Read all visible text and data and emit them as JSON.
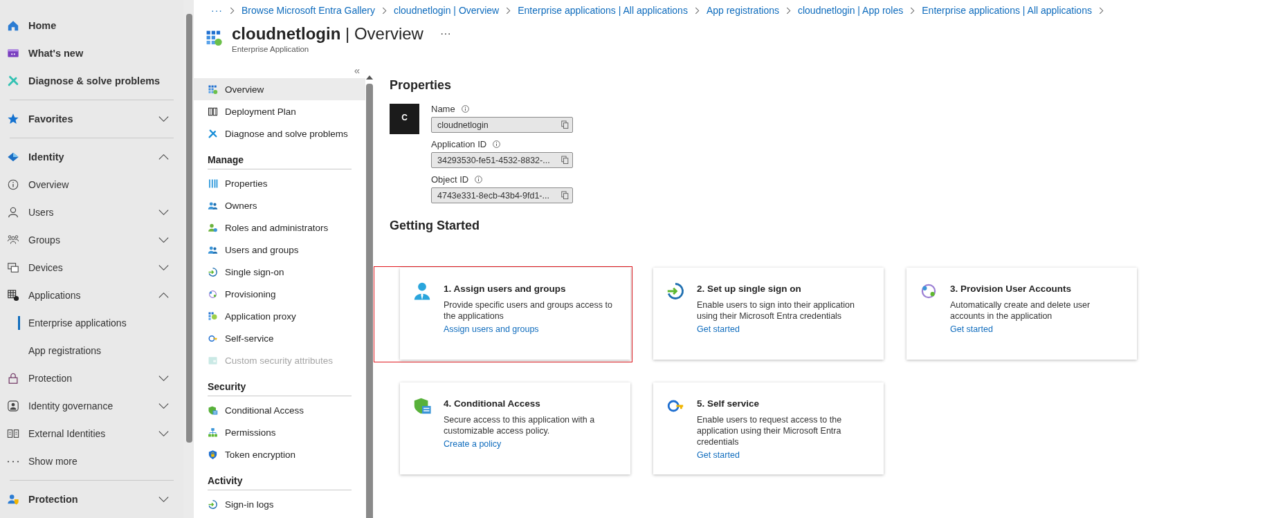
{
  "left_nav": {
    "groups": [
      {
        "items": [
          {
            "label": "Home",
            "kind": "top",
            "selected": false
          },
          {
            "label": "What's new",
            "kind": "top",
            "selected": false
          },
          {
            "label": "Diagnose & solve problems",
            "kind": "top",
            "selected": false
          }
        ]
      },
      {
        "items": [
          {
            "label": "Favorites",
            "kind": "top",
            "selected": false,
            "expanded": false
          }
        ]
      },
      {
        "items": [
          {
            "label": "Identity",
            "kind": "top",
            "selected": false,
            "expanded": true
          },
          {
            "label": "Overview",
            "kind": "item",
            "selected": false
          },
          {
            "label": "Users",
            "kind": "item",
            "selected": false,
            "expanded": false
          },
          {
            "label": "Groups",
            "kind": "item",
            "selected": false,
            "expanded": false
          },
          {
            "label": "Devices",
            "kind": "item",
            "selected": false,
            "expanded": false
          },
          {
            "label": "Applications",
            "kind": "item",
            "selected": false,
            "expanded": true
          },
          {
            "label": "Enterprise applications",
            "kind": "sub",
            "selected": true
          },
          {
            "label": "App registrations",
            "kind": "sub",
            "selected": false
          },
          {
            "label": "Protection",
            "kind": "item",
            "selected": false,
            "expanded": false
          },
          {
            "label": "Identity governance",
            "kind": "item",
            "selected": false,
            "expanded": false
          },
          {
            "label": "External Identities",
            "kind": "item",
            "selected": false,
            "expanded": false
          },
          {
            "label": "Show more",
            "kind": "item",
            "selected": false
          }
        ]
      },
      {
        "items": [
          {
            "label": "Protection",
            "kind": "top",
            "selected": false,
            "expanded": false
          }
        ]
      }
    ]
  },
  "breadcrumb": {
    "more": "···",
    "items": [
      "Browse Microsoft Entra Gallery",
      "cloudnetlogin | Overview",
      "Enterprise applications | All applications",
      "App registrations",
      "cloudnetlogin | App roles",
      "Enterprise applications | All applications"
    ]
  },
  "header": {
    "title": "**cloudnetlogin** | Overview",
    "subtitle": "Enterprise Application",
    "more": "···"
  },
  "resource_menu": {
    "collapse": "«",
    "sections": [
      {
        "items": [
          {
            "label": "Overview",
            "selected": true,
            "disabled": false
          },
          {
            "label": "Deployment Plan",
            "selected": false,
            "disabled": false
          },
          {
            "label": "Diagnose and solve problems",
            "selected": false,
            "disabled": false
          }
        ]
      },
      {
        "heading": "Manage",
        "items": [
          {
            "label": "Properties",
            "selected": false,
            "disabled": false
          },
          {
            "label": "Owners",
            "selected": false,
            "disabled": false
          },
          {
            "label": "Roles and administrators",
            "selected": false,
            "disabled": false
          },
          {
            "label": "Users and groups",
            "selected": false,
            "disabled": false
          },
          {
            "label": "Single sign-on",
            "selected": false,
            "disabled": false
          },
          {
            "label": "Provisioning",
            "selected": false,
            "disabled": false
          },
          {
            "label": "Application proxy",
            "selected": false,
            "disabled": false
          },
          {
            "label": "Self-service",
            "selected": false,
            "disabled": false
          },
          {
            "label": "Custom security attributes",
            "selected": false,
            "disabled": true
          }
        ]
      },
      {
        "heading": "Security",
        "items": [
          {
            "label": "Conditional Access",
            "selected": false,
            "disabled": false
          },
          {
            "label": "Permissions",
            "selected": false,
            "disabled": false
          },
          {
            "label": "Token encryption",
            "selected": false,
            "disabled": false
          }
        ]
      },
      {
        "heading": "Activity",
        "items": [
          {
            "label": "Sign-in logs",
            "selected": false,
            "disabled": false
          }
        ]
      }
    ]
  },
  "properties": {
    "heading": "Properties",
    "avatar": "C",
    "fields": [
      {
        "label": "Name",
        "value": "cloudnetlogin"
      },
      {
        "label": "Application ID",
        "value": "34293530-fe51-4532-8832-..."
      },
      {
        "label": "Object ID",
        "value": "4743e331-8ecb-43b4-9fd1-..."
      }
    ]
  },
  "getting_started": {
    "heading": "Getting Started",
    "cards": [
      {
        "title": "1. Assign users and groups",
        "description": "Provide specific users and groups access to the applications",
        "link": "Assign users and groups",
        "highlighted": true
      },
      {
        "title": "2. Set up single sign on",
        "description": "Enable users to sign into their application using their Microsoft Entra credentials",
        "link": "Get started",
        "highlighted": false
      },
      {
        "title": "3. Provision User Accounts",
        "description": "Automatically create and delete user accounts in the application",
        "link": "Get started",
        "highlighted": false
      },
      {
        "title": "4. Conditional Access",
        "description": "Secure access to this application with a customizable access policy.",
        "link": "Create a policy",
        "highlighted": false
      },
      {
        "title": "5. Self service",
        "description": "Enable users to request access to the application using their Microsoft Entra credentials",
        "link": "Get started",
        "highlighted": false
      }
    ]
  }
}
